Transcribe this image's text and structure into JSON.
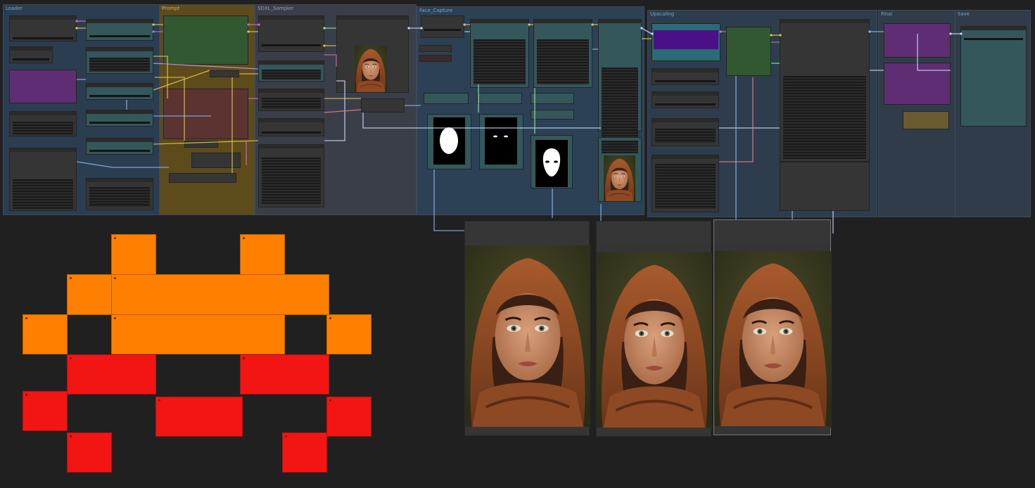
{
  "groups": [
    {
      "id": "loader",
      "title": "Loader",
      "color": "#2b3d51"
    },
    {
      "id": "prompt",
      "title": "Prompt",
      "color": "#5e4b1c"
    },
    {
      "id": "sampler",
      "title": "SDXL_Sampler",
      "color": "#3a3e48"
    },
    {
      "id": "face",
      "title": "Face_Capture",
      "color": "#2d4156"
    },
    {
      "id": "upscaling",
      "title": "Upscaling",
      "color": "#2d3d4e"
    },
    {
      "id": "final",
      "title": "Final",
      "color": "#303c4a"
    },
    {
      "id": "save",
      "title": "Save",
      "color": "#303c4a"
    }
  ],
  "colors": {
    "canvas": "#202020",
    "orange": "#ff8000",
    "red": "#f31414",
    "purple_node": "#5f2d73",
    "green_node": "#325832",
    "brown_node": "#5b3330",
    "teal_node": "#34575b"
  },
  "masks": [
    {
      "id": "face-oval"
    },
    {
      "id": "eyes"
    },
    {
      "id": "face-mask"
    }
  ],
  "viewers": [
    {
      "id": "compare-1"
    },
    {
      "id": "compare-2"
    },
    {
      "id": "compare-3"
    }
  ],
  "decoration": {
    "pixel_invader": "pixel-invader-icon"
  }
}
